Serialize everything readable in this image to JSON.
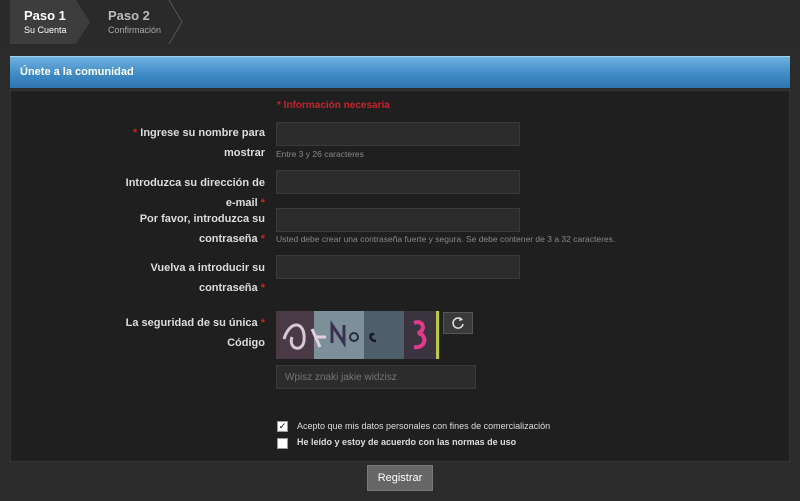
{
  "steps": [
    {
      "title": "Paso 1",
      "subtitle": "Su Cuenta"
    },
    {
      "title": "Paso 2",
      "subtitle": "Confirmación"
    }
  ],
  "header": {
    "title": "Únete a la comunidad"
  },
  "form": {
    "required_note": "* Información necesaria",
    "display_name": {
      "label_line1": "Ingrese su nombre para",
      "label_line2": "mostrar",
      "hint": "Entre 3 y 26 caracteres"
    },
    "email": {
      "label_line1": "Introduzca su dirección de",
      "label_line2": "e-mail"
    },
    "password": {
      "label_line1": "Por favor, introduzca su",
      "label_line2": "contraseña",
      "hint": "Usted debe crear una contraseña fuerte y segura. Se debe contener de 3 a 32 caracteres."
    },
    "password_confirm": {
      "label_line1": "Vuelva a introducir su",
      "label_line2": "contraseña"
    },
    "captcha": {
      "label_line1": "La seguridad de su única",
      "label_line2": "Código",
      "placeholder": "Wpisz znaki jakie widzisz",
      "refresh_icon": "refresh-icon"
    },
    "checkbox_marketing": {
      "checked": true,
      "text": "Acepto que mis datos personales con fines de comercialización"
    },
    "checkbox_terms": {
      "checked": false,
      "text_prefix": "He leído y estoy de acuerdo con las",
      "text_link": "normas de uso"
    },
    "asterisk": "*"
  },
  "submit": {
    "label": "Registrar"
  },
  "colors": {
    "accent_blue": "#3d88c4",
    "required_red": "#c8242e"
  }
}
